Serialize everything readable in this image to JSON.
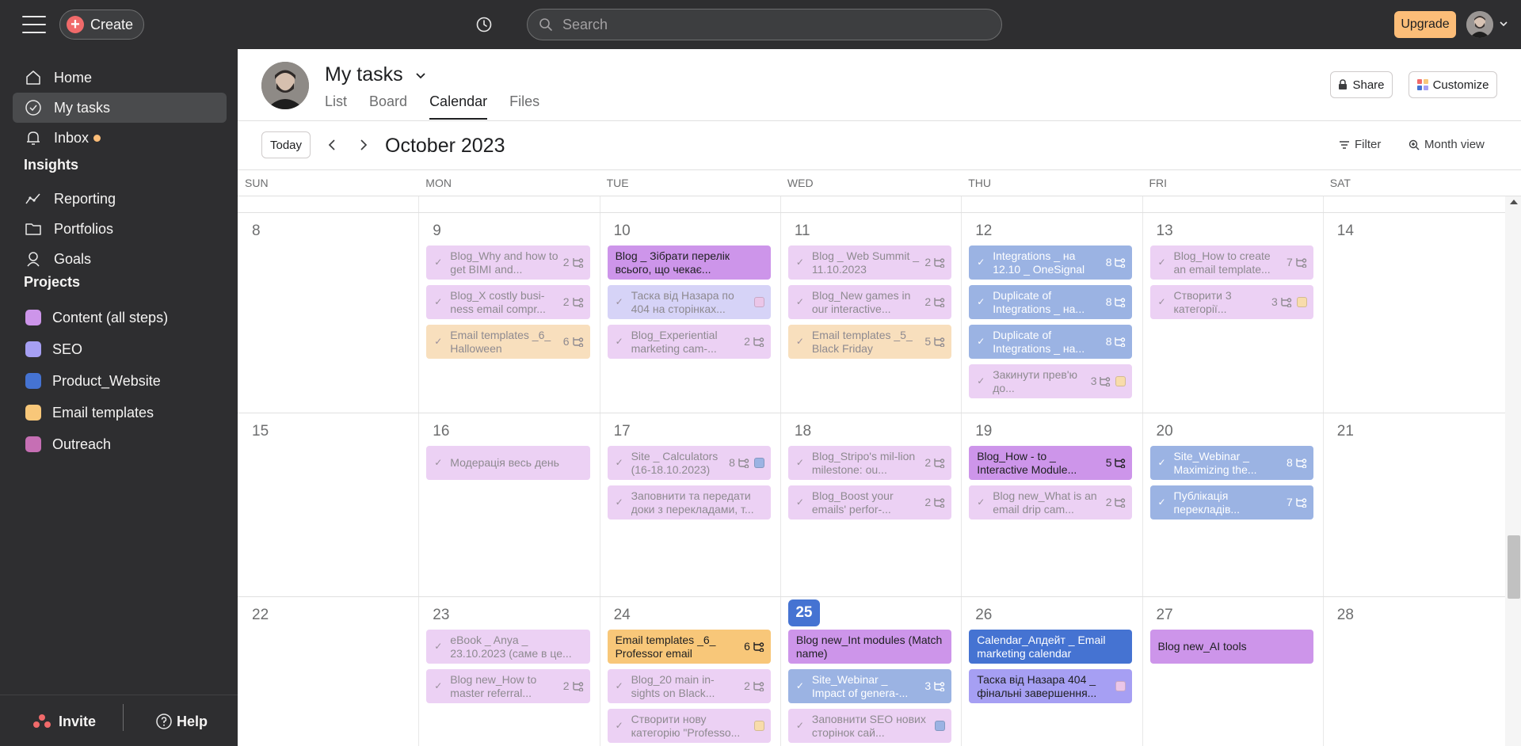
{
  "topbar": {
    "create_label": "Create",
    "search_placeholder": "Search",
    "upgrade_label": "Upgrade"
  },
  "sidebar": {
    "nav": [
      {
        "label": "Home",
        "icon": "home-icon"
      },
      {
        "label": "My tasks",
        "icon": "check-circle-icon",
        "active": true
      },
      {
        "label": "Inbox",
        "icon": "bell-icon",
        "unread": true
      }
    ],
    "insights_heading": "Insights",
    "insights": [
      {
        "label": "Reporting",
        "icon": "reporting-icon"
      },
      {
        "label": "Portfolios",
        "icon": "folder-icon"
      },
      {
        "label": "Goals",
        "icon": "goals-icon"
      }
    ],
    "projects_heading": "Projects",
    "projects": [
      {
        "label": "Content (all steps)",
        "color": "#cd95ea"
      },
      {
        "label": "SEO",
        "color": "#a69ff3"
      },
      {
        "label": "Product_Website",
        "color": "#4573d2"
      },
      {
        "label": "Email templates",
        "color": "#f8c779"
      },
      {
        "label": "Outreach",
        "color": "#c66fb4"
      }
    ],
    "invite_label": "Invite",
    "help_label": "Help"
  },
  "header": {
    "title": "My tasks",
    "tabs": [
      "List",
      "Board",
      "Calendar",
      "Files"
    ],
    "active_tab": "Calendar",
    "share_label": "Share",
    "customize_label": "Customize"
  },
  "toolbar": {
    "today_label": "Today",
    "month": "October 2023",
    "filter_label": "Filter",
    "view_label": "Month view"
  },
  "calendar": {
    "weekdays": [
      "SUN",
      "MON",
      "TUE",
      "WED",
      "THU",
      "FRI",
      "SAT"
    ],
    "today": "25",
    "weeks": [
      {
        "days": [
          "8",
          "9",
          "10",
          "11",
          "12",
          "13",
          "14"
        ],
        "tasks": [
          {
            "day": 1,
            "slot": 0,
            "title": "Blog_Why and how to get BIMI and...",
            "count": "2",
            "style": "done-purple"
          },
          {
            "day": 1,
            "slot": 1,
            "title": "Blog_X costly busi-ness email compr...",
            "count": "2",
            "style": "done-purple"
          },
          {
            "day": 1,
            "slot": 2,
            "title": "Email templates _6_ Halloween",
            "count": "6",
            "style": "done-orange"
          },
          {
            "day": 2,
            "slot": 0,
            "title": "Blog _ Зібрати перелік всього, що чекає...",
            "style": "open-purple"
          },
          {
            "day": 2,
            "slot": 1,
            "title": "Таска від Назара по 404 на сторінках...",
            "square": "#ebc6e8",
            "style": "done-lavender"
          },
          {
            "day": 2,
            "slot": 2,
            "title": "Blog_Experiential marketing cam-...",
            "count": "2",
            "style": "done-purple"
          },
          {
            "day": 3,
            "slot": 0,
            "title": "Blog _ Web Summit _ 11.10.2023",
            "count": "2",
            "style": "done-purple"
          },
          {
            "day": 3,
            "slot": 1,
            "title": "Blog_New games in our interactive...",
            "count": "2",
            "style": "done-purple"
          },
          {
            "day": 3,
            "slot": 2,
            "title": "Email templates _5_ Black Friday",
            "count": "5",
            "style": "done-orange"
          },
          {
            "day": 4,
            "slot": 0,
            "title": "Integrations _ на 12.10 _ OneSignal",
            "count": "8",
            "style": "done-blue"
          },
          {
            "day": 4,
            "slot": 1,
            "title": "Duplicate of Integrations _ на...",
            "count": "8",
            "style": "done-blue"
          },
          {
            "day": 4,
            "slot": 2,
            "title": "Duplicate of Integrations _ на...",
            "count": "8",
            "style": "done-blue"
          },
          {
            "day": 4,
            "slot": 3,
            "title": "Закинути прев'ю до...",
            "count": "3",
            "square": "#f8dcab",
            "style": "done-purple"
          },
          {
            "day": 5,
            "slot": 0,
            "title": "Blog_How to create an email template...",
            "count": "7",
            "style": "done-purple"
          },
          {
            "day": 5,
            "slot": 1,
            "title": "Створити 3 категорії...",
            "count": "3",
            "square": "#f8dcab",
            "style": "done-purple"
          }
        ]
      },
      {
        "days": [
          "15",
          "16",
          "17",
          "18",
          "19",
          "20",
          "21"
        ],
        "tasks": [
          {
            "day": 1,
            "slot": 0,
            "title": "Модерація весь день",
            "style": "done-purple"
          },
          {
            "day": 2,
            "slot": 0,
            "title": "Site _ Calculators (16-18.10.2023)",
            "count": "8",
            "square": "#9bb3e3",
            "style": "done-purple"
          },
          {
            "day": 2,
            "slot": 1,
            "title": "Заповнити та передати доки з перекладами, т...",
            "style": "done-purple"
          },
          {
            "day": 3,
            "slot": 0,
            "title": "Blog_Stripo's mil-lion milestone: ou...",
            "count": "2",
            "style": "done-purple"
          },
          {
            "day": 3,
            "slot": 1,
            "title": "Blog_Boost your emails' perfor-...",
            "count": "2",
            "style": "done-purple"
          },
          {
            "day": 4,
            "slot": 0,
            "title": "Blog_How - to _ Interactive Module...",
            "count": "5",
            "style": "open-purple"
          },
          {
            "day": 4,
            "slot": 1,
            "title": "Blog new_What is an email drip cam...",
            "count": "2",
            "style": "done-purple"
          },
          {
            "day": 5,
            "slot": 0,
            "title": "Site_Webinar _ Maximizing the...",
            "count": "8",
            "style": "done-blue"
          },
          {
            "day": 5,
            "slot": 1,
            "title": "Публікація перекладів...",
            "count": "7",
            "style": "done-blue"
          }
        ]
      },
      {
        "days": [
          "22",
          "23",
          "24",
          "25",
          "26",
          "27",
          "28"
        ],
        "tasks": [
          {
            "day": 1,
            "slot": 0,
            "title": "eBook _ Anya _ 23.10.2023 (саме в це...",
            "style": "done-purple"
          },
          {
            "day": 1,
            "slot": 1,
            "title": "Blog new_How to master referral...",
            "count": "2",
            "style": "done-purple"
          },
          {
            "day": 2,
            "slot": 0,
            "title": "Email templates _6_ Professor email",
            "count": "6",
            "style": "open-orange"
          },
          {
            "day": 2,
            "slot": 1,
            "title": "Blog_20 main in-sights on Black...",
            "count": "2",
            "style": "done-purple"
          },
          {
            "day": 2,
            "slot": 2,
            "title": "Створити нову категорію \"Professo...",
            "square": "#f8dcab",
            "style": "done-purple"
          },
          {
            "day": 3,
            "slot": 0,
            "title": "Blog new_Int modules (Match name)",
            "style": "open-purple"
          },
          {
            "day": 3,
            "slot": 1,
            "title": "Site_Webinar _ Impact of genera-...",
            "count": "3",
            "style": "done-blue"
          },
          {
            "day": 3,
            "slot": 2,
            "title": "Заповнити SEO нових сторінок сай...",
            "square": "#9bb3e3",
            "style": "done-purple"
          },
          {
            "day": 4,
            "slot": 0,
            "title": "Calendar_Апдейт _ Email marketing calendar",
            "style": "open-blue"
          },
          {
            "day": 4,
            "slot": 1,
            "title": "Таска від Назара 404 _ фінальні завершення...",
            "square": "#ebc6e8",
            "style": "open-lavender"
          },
          {
            "day": 5,
            "slot": 0,
            "title": "Blog new_AI tools",
            "style": "open-purple"
          }
        ]
      }
    ]
  }
}
